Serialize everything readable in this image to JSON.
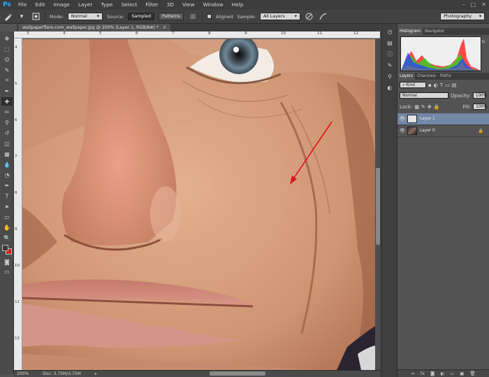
{
  "app": {
    "logo": "Ps"
  },
  "menu": [
    "File",
    "Edit",
    "Image",
    "Layer",
    "Type",
    "Select",
    "Filter",
    "3D",
    "View",
    "Window",
    "Help"
  ],
  "window_controls": [
    "–",
    "□",
    "✕"
  ],
  "options": {
    "mode_label": "Mode:",
    "mode_value": "Normal",
    "source_label": "Source:",
    "source_sampled": "Sampled",
    "source_patterns": "Patterns",
    "aligned_label": "Aligned",
    "sample_label": "Sample:",
    "sample_value": "All Layers",
    "workspace": "Photography"
  },
  "document": {
    "tab_title": "wallpaperflare.com_wallpaper.jpg @ 200% (Layer 1, RGB/8#) *",
    "close": "×"
  },
  "rulers": {
    "top": [
      "3",
      "4",
      "5",
      "6",
      "7",
      "8",
      "9",
      "10",
      "11",
      "12"
    ],
    "left": [
      "4",
      "5",
      "6",
      "7",
      "8",
      "9",
      "10",
      "11",
      "12"
    ]
  },
  "status": {
    "zoom": "200%",
    "doc": "Doc: 3.75M/3.75M"
  },
  "panels": {
    "top_tabs": [
      "Histogram",
      "Navigator"
    ],
    "layer_tabs": [
      "Layers",
      "Channels",
      "Paths"
    ],
    "kind_label": "Kind",
    "blend_mode": "Normal",
    "opacity_label": "Opacity:",
    "opacity_value": "100%",
    "lock_label": "Lock:",
    "fill_label": "Fill:",
    "fill_value": "100%",
    "layers": [
      {
        "name": "Layer 1",
        "selected": true
      },
      {
        "name": "Layer 0",
        "selected": false
      }
    ],
    "footer_icons": [
      "link-icon",
      "fx-icon",
      "mask-icon",
      "adjustment-icon",
      "group-icon",
      "new-layer-icon",
      "trash-icon"
    ],
    "footer_glyphs": [
      "∞",
      "fx",
      "◙",
      "◐",
      "▭",
      "▣",
      "🗑"
    ]
  },
  "tools": [
    "move-tool",
    "marquee-tool",
    "lasso-tool",
    "quick-select-tool",
    "crop-tool",
    "eyedropper-tool",
    "healing-brush-tool",
    "brush-tool",
    "clone-stamp-tool",
    "history-brush-tool",
    "eraser-tool",
    "gradient-tool",
    "blur-tool",
    "dodge-tool",
    "pen-tool",
    "type-tool",
    "path-select-tool",
    "shape-tool",
    "hand-tool",
    "zoom-tool"
  ],
  "tool_glyphs": [
    "✥",
    "⬚",
    "ʘ",
    "✎",
    "⌗",
    "✒",
    "✚",
    "✏",
    "⚲",
    "↺",
    "◫",
    "▦",
    "💧",
    "◔",
    "✒",
    "T",
    "➤",
    "▭",
    "✋",
    "🔍"
  ],
  "colors": {
    "accent": "#31a8ff",
    "arrow": "#e0141a",
    "selected_layer": "#7387a6",
    "foreground": "#3a3a3a",
    "background": "#d8201c"
  }
}
